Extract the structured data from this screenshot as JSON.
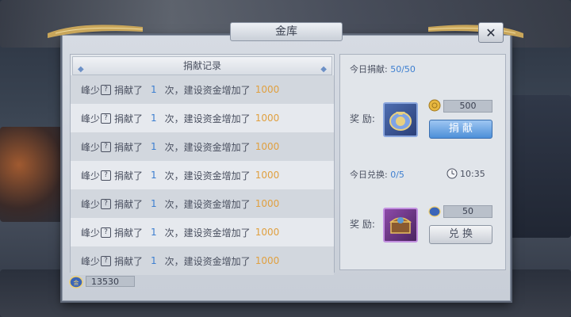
{
  "window": {
    "title": "金库",
    "close_label": "✕"
  },
  "record": {
    "header": "捐献记录",
    "rows": [
      {
        "name": "峰少",
        "q": "?",
        "action": "捐献了",
        "count": "1",
        "mid": "次，建设资金增加了",
        "amount": "1000"
      },
      {
        "name": "峰少",
        "q": "?",
        "action": "捐献了",
        "count": "1",
        "mid": "次，建设资金增加了",
        "amount": "1000"
      },
      {
        "name": "峰少",
        "q": "?",
        "action": "捐献了",
        "count": "1",
        "mid": "次，建设资金增加了",
        "amount": "1000"
      },
      {
        "name": "峰少",
        "q": "?",
        "action": "捐献了",
        "count": "1",
        "mid": "次，建设资金增加了",
        "amount": "1000"
      },
      {
        "name": "峰少",
        "q": "?",
        "action": "捐献了",
        "count": "1",
        "mid": "次，建设资金增加了",
        "amount": "1000"
      },
      {
        "name": "峰少",
        "q": "?",
        "action": "捐献了",
        "count": "1",
        "mid": "次，建设资金增加了",
        "amount": "1000"
      },
      {
        "name": "峰少",
        "q": "?",
        "action": "捐献了",
        "count": "1",
        "mid": "次，建设资金增加了",
        "amount": "1000"
      }
    ]
  },
  "fund": {
    "value": "13530",
    "icon": "fund-coin-icon"
  },
  "donate": {
    "label": "今日捐献:",
    "value": "50/50",
    "reward_label": "奖 励:",
    "item_icon": "fund-bag-icon",
    "cost": "500",
    "cost_icon": "gold-coin-icon",
    "button": "捐 献"
  },
  "exchange": {
    "label": "今日兑换:",
    "value": "0/5",
    "timer": "10:35",
    "timer_icon": "clock-icon",
    "reward_label": "奖 励:",
    "item_icon": "treasure-chest-icon",
    "cost": "50",
    "cost_icon": "fund-coin-icon",
    "button": "兑 换"
  },
  "colors": {
    "accent_blue": "#3d7fd0",
    "amount_orange": "#e0a040"
  }
}
